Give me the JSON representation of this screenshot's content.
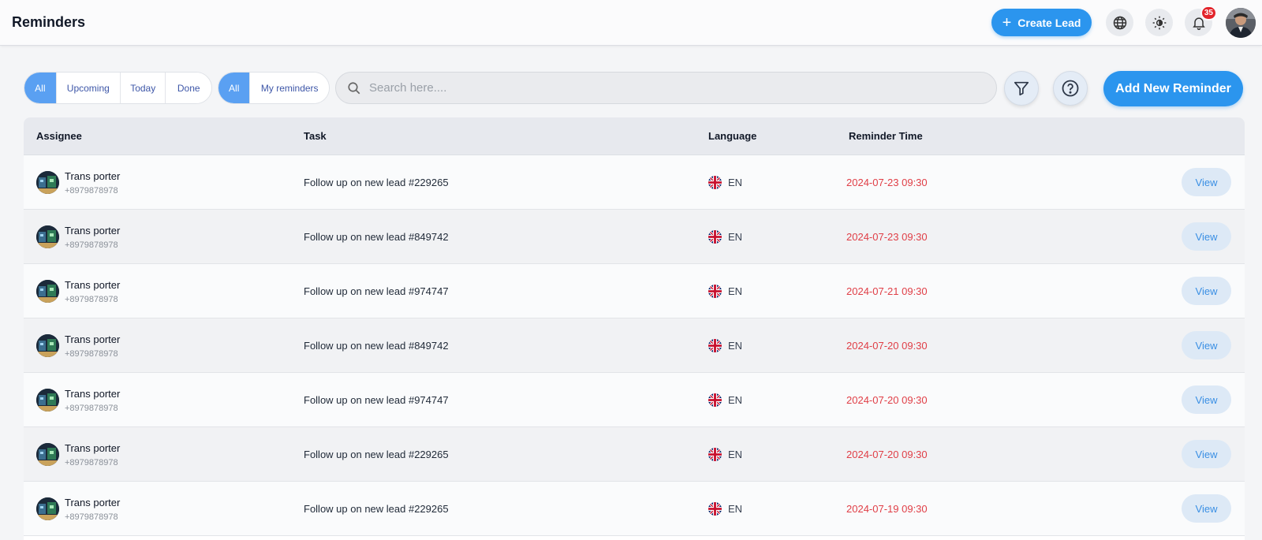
{
  "header": {
    "title": "Reminders",
    "create_lead_label": "Create Lead",
    "notification_count": "35",
    "icons": [
      "plus-icon",
      "globe-icon",
      "theme-icon",
      "bell-icon"
    ]
  },
  "filters": {
    "status": [
      "All",
      "Upcoming",
      "Today",
      "Done"
    ],
    "scope": [
      "All",
      "My reminders"
    ]
  },
  "search": {
    "placeholder": "Search here...."
  },
  "add_reminder_label": "Add New Reminder",
  "table": {
    "columns": [
      "Assignee",
      "Task",
      "Language",
      "Reminder Time"
    ],
    "view_label": "View",
    "rows": [
      {
        "name": "Trans porter",
        "phone": "+8979878978",
        "task": "Follow up on new lead #229265",
        "lang": "EN",
        "time": "2024-07-23 09:30"
      },
      {
        "name": "Trans porter",
        "phone": "+8979878978",
        "task": "Follow up on new lead #849742",
        "lang": "EN",
        "time": "2024-07-23 09:30"
      },
      {
        "name": "Trans porter",
        "phone": "+8979878978",
        "task": "Follow up on new lead #974747",
        "lang": "EN",
        "time": "2024-07-21 09:30"
      },
      {
        "name": "Trans porter",
        "phone": "+8979878978",
        "task": "Follow up on new lead #849742",
        "lang": "EN",
        "time": "2024-07-20 09:30"
      },
      {
        "name": "Trans porter",
        "phone": "+8979878978",
        "task": "Follow up on new lead #974747",
        "lang": "EN",
        "time": "2024-07-20 09:30"
      },
      {
        "name": "Trans porter",
        "phone": "+8979878978",
        "task": "Follow up on new lead #229265",
        "lang": "EN",
        "time": "2024-07-20 09:30"
      },
      {
        "name": "Trans porter",
        "phone": "+8979878978",
        "task": "Follow up on new lead #229265",
        "lang": "EN",
        "time": "2024-07-19 09:30"
      }
    ]
  },
  "colors": {
    "accent": "#2b95ee",
    "danger": "#e03e46",
    "badge": "#e3242b"
  }
}
